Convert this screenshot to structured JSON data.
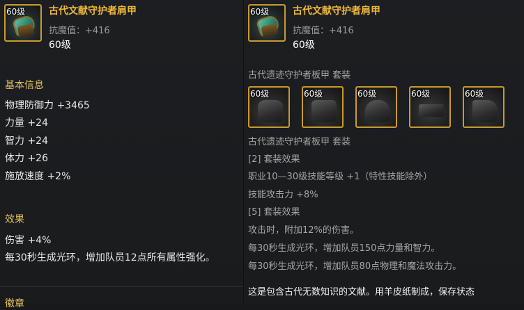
{
  "left": {
    "item": {
      "level_badge": "60级",
      "name": "古代文献守护者肩甲",
      "attr": "抗魔值：+416",
      "required_level": "60级",
      "icon": "shoulder-armor-icon"
    },
    "basic_info_title": "基本信息",
    "stats": [
      "物理防御力 +3465",
      "力量 +24",
      "智力 +24",
      "体力 +26",
      "施放速度 +2%"
    ],
    "effect_title": "效果",
    "effects": [
      "伤害 +4%",
      "每30秒生成光环，增加队员12点所有属性强化。"
    ],
    "bottom_cut_title": "徽章"
  },
  "right": {
    "item": {
      "level_badge": "60级",
      "name": "古代文献守护者肩甲",
      "attr": "抗魔值：+416",
      "required_level": "60级",
      "icon": "shoulder-armor-icon"
    },
    "set_header": "古代遗迹守护者板甲  套装",
    "pieces": [
      {
        "level": "60级",
        "icon": "chest-armor-icon"
      },
      {
        "level": "60级",
        "icon": "leg-armor-icon"
      },
      {
        "level": "60级",
        "icon": "shoulder-armor-icon"
      },
      {
        "level": "60级",
        "icon": "belt-armor-icon"
      },
      {
        "level": "60级",
        "icon": "boots-armor-icon"
      }
    ],
    "set_header2": "古代遗迹守护者板甲  套装",
    "set_lines": [
      "[2] 套装效果",
      "职业10—30级技能等级 +1（特性技能除外）",
      "技能攻击力 +8%",
      "[5] 套装效果",
      "攻击时，附加12%的伤害。",
      "每30秒生成光环，增加队员150点力量和智力。",
      "每30秒生成光环，增加队员80点物理和魔法攻击力。"
    ],
    "description": "这是包含古代无数知识的文献。用羊皮纸制成，保存状态"
  },
  "colors": {
    "gold": "#f0b93b",
    "section": "#e2bf63",
    "border": "#c99a2e",
    "bg": "#1c1e21"
  }
}
